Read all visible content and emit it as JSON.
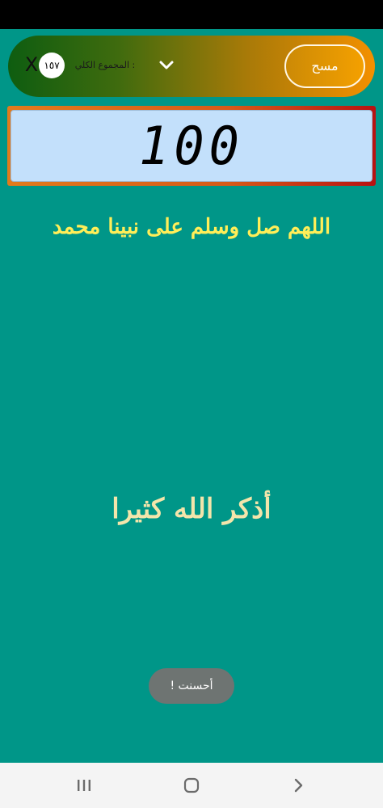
{
  "top_bar": {
    "close_label": "X",
    "total_label": "المجموع الكلي :",
    "total_value": "١٥٧",
    "reset_label": "مسح"
  },
  "counter": {
    "value": "100"
  },
  "dhikr": {
    "text": "اللهم صل وسلم على نبينا محمد"
  },
  "center_phrase": {
    "text": "أذكر الله كثيرا"
  },
  "toast": {
    "text": "أحسنت !"
  },
  "icons": {
    "dropdown": "chevron-down-icon",
    "nav_recent": "recent-apps-icon",
    "nav_home": "home-icon",
    "nav_back": "back-icon"
  },
  "colors": {
    "background": "#009688",
    "dhikr_text": "#ffee58",
    "center_text": "#f3e5ab",
    "display": "#c3e0fb"
  }
}
